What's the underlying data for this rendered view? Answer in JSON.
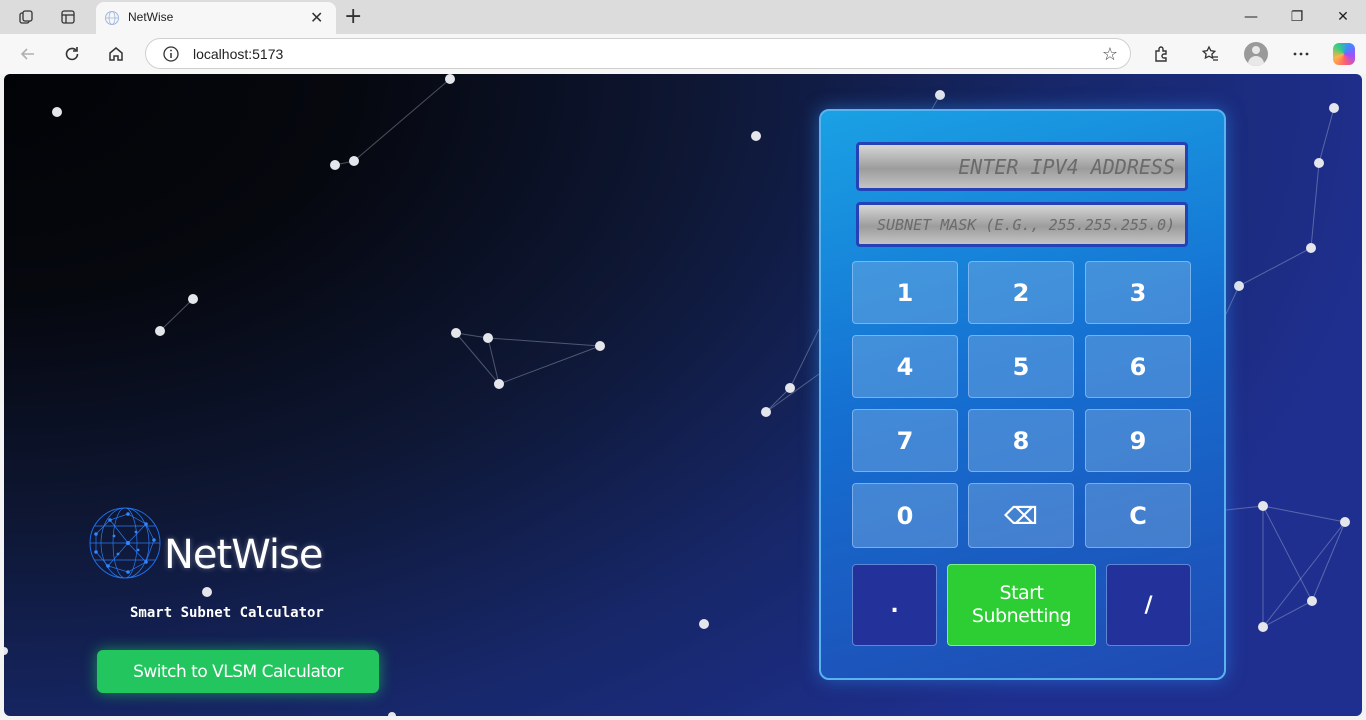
{
  "browser": {
    "tab_title": "NetWise",
    "tab_close": "✕",
    "new_tab": "+",
    "url": "localhost:5173",
    "window_controls": {
      "minimize": "—",
      "restore": "❐",
      "close": "✕"
    }
  },
  "brand": {
    "name": "NetWise",
    "tagline": "Smart Subnet Calculator",
    "switch_button": "Switch to VLSM Calculator"
  },
  "calculator": {
    "ip_placeholder": "ENTER IPV4 ADDRESS",
    "mask_placeholder": "SUBNET MASK (E.G., 255.255.255.0)",
    "keys": {
      "k1": "1",
      "k2": "2",
      "k3": "3",
      "k4": "4",
      "k5": "5",
      "k6": "6",
      "k7": "7",
      "k8": "8",
      "k9": "9",
      "k0": "0",
      "backspace": "⌫",
      "clear": "C",
      "dot": ".",
      "slash": "/"
    },
    "start_line1": "Start",
    "start_line2": "Subnetting"
  },
  "colors": {
    "accent_green": "#22c55e",
    "calc_blue": "#1570d2",
    "field_border": "#2442b6"
  }
}
